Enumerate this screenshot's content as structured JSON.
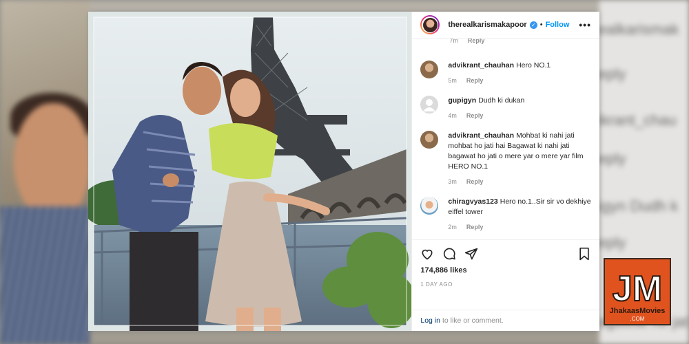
{
  "post": {
    "username": "therealkarismakapoor",
    "follow_label": "Follow",
    "more_label": "•••",
    "verified_mark": "✓",
    "separator": "•"
  },
  "comments": {
    "top_reply": {
      "time": "7m",
      "reply_label": "Reply"
    },
    "items": [
      {
        "user": "advikrant_chauhan",
        "text": "Hero NO.1",
        "time": "5m",
        "reply_label": "Reply",
        "avatar": "photo-avatar"
      },
      {
        "user": "gupigyn",
        "text": "Dudh ki dukan",
        "time": "4m",
        "reply_label": "Reply",
        "avatar": "default-avatar"
      },
      {
        "user": "advikrant_chauhan",
        "text": "Mohbat ki nahi jati mohbat ho jati hai Bagawat ki nahi jati bagawat ho jati o mere yar o mere yar film HERO NO.1",
        "time": "3m",
        "reply_label": "Reply",
        "avatar": "photo-avatar"
      },
      {
        "user": "chiragvyas123",
        "text": "Hero no.1..Sir sir vo dekhiye eiffel tower",
        "time": "2m",
        "reply_label": "Reply",
        "avatar": "photo-avatar"
      }
    ]
  },
  "actions": {
    "icons": [
      "heart-icon",
      "comment-icon",
      "share-icon",
      "bookmark-icon"
    ],
    "likes": "174,886 likes",
    "date": "1 DAY AGO"
  },
  "login": {
    "link": "Log in",
    "rest": "to like or comment."
  },
  "background_text": [
    "ealkarismak",
    "eply",
    "ikrant_chau",
    "eply",
    "igyn Dudh k",
    "eply",
    "agawat ho jati"
  ],
  "watermark": {
    "letters": "JM",
    "brand": "JhakaasMovies",
    "domain": ".COM"
  },
  "colors": {
    "link_blue": "#0095f6",
    "text": "#262626",
    "muted": "#8e8e8e",
    "logo_orange": "#e0531f"
  }
}
